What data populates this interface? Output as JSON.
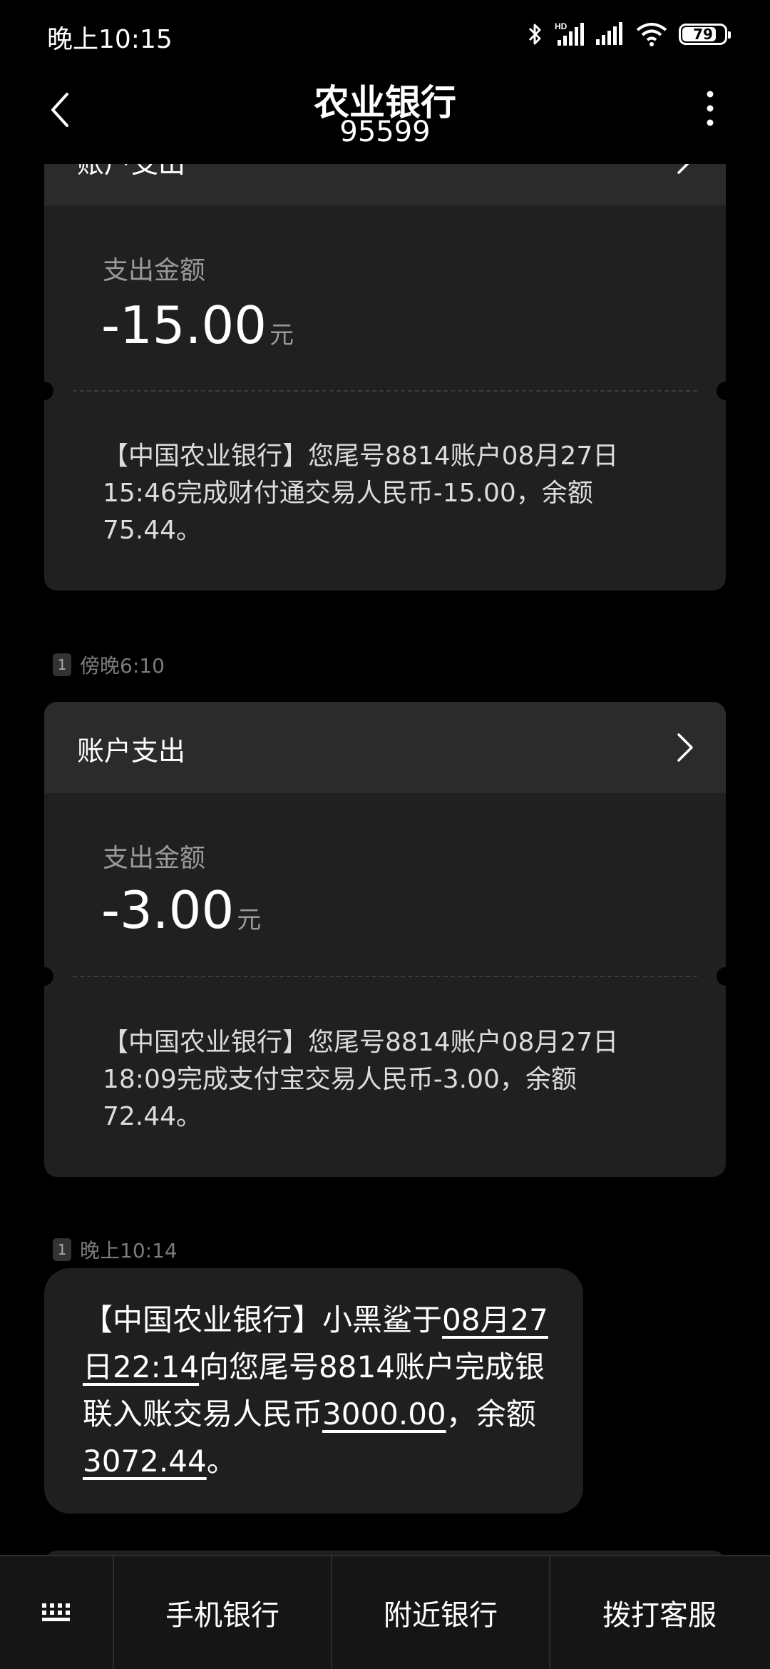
{
  "status_bar": {
    "time": "晚上10:15",
    "hd_label": "HD",
    "battery": "79"
  },
  "header": {
    "title": "农业银行",
    "number": "95599"
  },
  "messages": [
    {
      "card_title": "账户支出",
      "amount_label": "支出金额",
      "amount": "-15.00",
      "unit": "元",
      "body": "【中国农业银行】您尾号8814账户08月27日15:46完成财付通交易人民币-15.00，余额75.44。"
    },
    {
      "sim": "1",
      "time": "傍晚6:10",
      "card_title": "账户支出",
      "amount_label": "支出金额",
      "amount": "-3.00",
      "unit": "元",
      "body": "【中国农业银行】您尾号8814账户08月27日18:09完成支付宝交易人民币-3.00，余额72.44。"
    },
    {
      "sim": "1",
      "time": "晚上10:14",
      "parts": {
        "p1": "【中国农业银行】小黑鲨于",
        "link_date": "08月27日22:14",
        "p2": "向您尾号8814账户完成银联入账交易人民币",
        "link_amount": "3000.00",
        "p3": "，余额",
        "link_balance": "3072.44",
        "p4": "。"
      }
    }
  ],
  "bottom_bar": {
    "keyboard_icon": "keyboard-icon",
    "btn1": "手机银行",
    "btn2": "附近银行",
    "btn3": "拨打客服"
  }
}
